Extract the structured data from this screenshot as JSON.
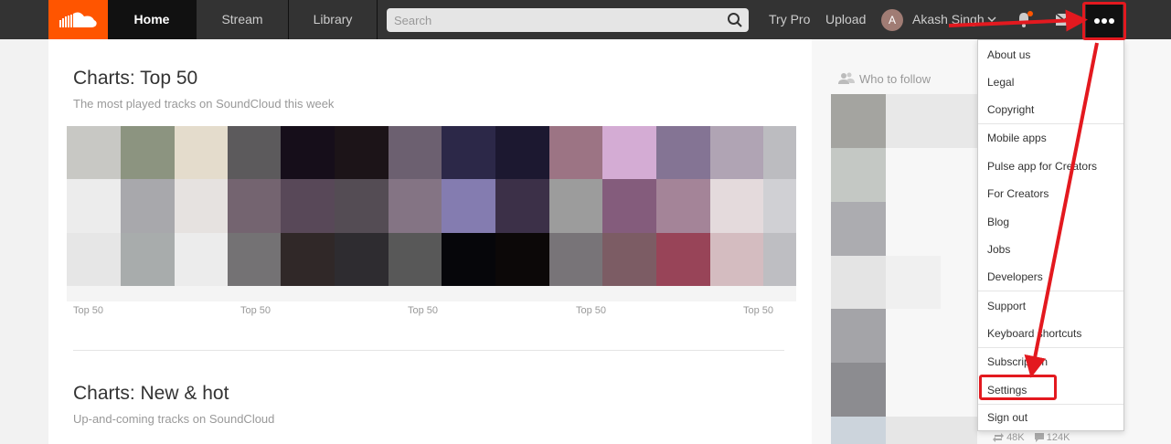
{
  "header": {
    "tabs": [
      "Home",
      "Stream",
      "Library"
    ],
    "search_placeholder": "Search",
    "try_pro": "Try Pro",
    "upload": "Upload",
    "avatar_initial": "A",
    "user_name": "Akash Singh"
  },
  "icons": {
    "logo": "soundcloud-cloud-icon",
    "search": "search-icon",
    "chevron": "chevron-down-icon",
    "notifications": "bell-icon",
    "messages": "mail-icon",
    "more": "more-dots-icon",
    "who_to_follow": "users-icon",
    "repost": "repost-icon",
    "comment": "comment-icon"
  },
  "colors": {
    "brand": "#ff5500",
    "header_bg": "#333333",
    "annotation": "#e3191f"
  },
  "main": {
    "charts_top50": {
      "title": "Charts: Top 50",
      "subtitle": "The most played tracks on SoundCloud this week",
      "tile_labels": [
        "Top 50",
        "Top 50",
        "Top 50",
        "Top 50",
        "Top 50"
      ]
    },
    "charts_new_hot": {
      "title": "Charts: New & hot",
      "subtitle": "Up-and-coming tracks on SoundCloud"
    }
  },
  "sidebar": {
    "who_to_follow": "Who to follow",
    "stats": {
      "reposts": "48K",
      "comments": "124K"
    }
  },
  "menu": {
    "items": [
      "About us",
      "Legal",
      "Copyright",
      "Mobile apps",
      "Pulse app for Creators",
      "For Creators",
      "Blog",
      "Jobs",
      "Developers",
      "Support",
      "Keyboard shortcuts",
      "Subscription",
      "Settings",
      "Sign out"
    ]
  }
}
